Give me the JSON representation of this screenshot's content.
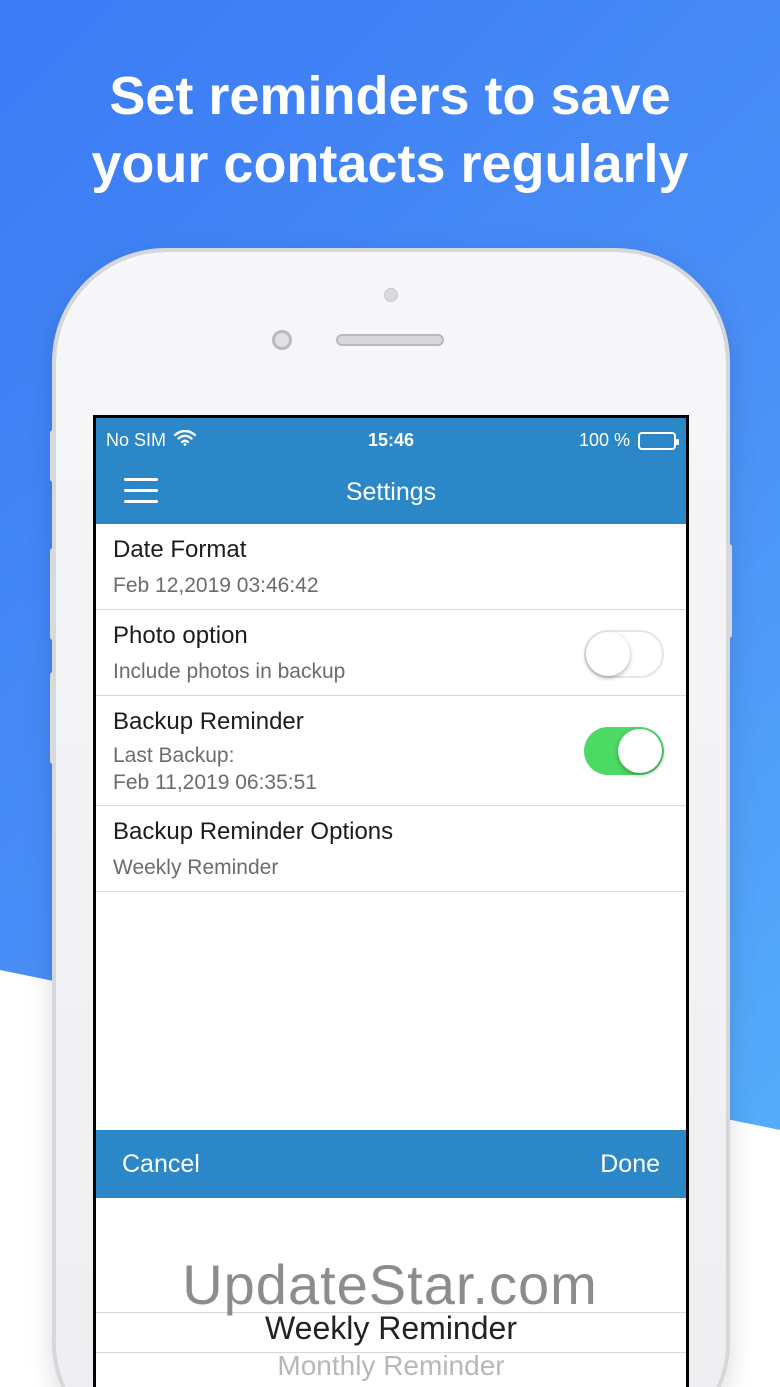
{
  "promo": {
    "headline_line1": "Set reminders to save",
    "headline_line2": "your contacts regularly"
  },
  "status_bar": {
    "carrier": "No SIM",
    "time": "15:46",
    "battery_label": "100 %",
    "wifi_icon": "wifi-icon",
    "battery_icon": "battery-icon"
  },
  "navbar": {
    "title": "Settings",
    "menu_icon": "hamburger-menu-icon"
  },
  "settings": {
    "date_format": {
      "title": "Date Format",
      "value": "Feb 12,2019 03:46:42"
    },
    "photo_option": {
      "title": "Photo option",
      "subtitle": "Include photos in backup",
      "enabled": false
    },
    "backup_reminder": {
      "title": "Backup Reminder",
      "subtitle_line1": "Last Backup:",
      "subtitle_line2": "Feb 11,2019 06:35:51",
      "enabled": true
    },
    "backup_reminder_options": {
      "title": "Backup Reminder Options",
      "value": "Weekly Reminder"
    }
  },
  "picker": {
    "cancel_label": "Cancel",
    "done_label": "Done",
    "selected_option": "Weekly Reminder",
    "next_option": "Monthly Reminder"
  },
  "watermark": "UpdateStar.com",
  "colors": {
    "nav_blue": "#2b87c7",
    "toggle_on": "#4cd964",
    "background_blue": "#3b7bf5"
  }
}
